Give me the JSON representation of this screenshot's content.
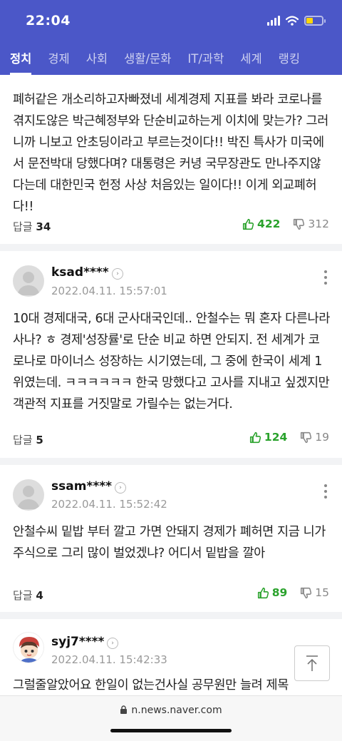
{
  "status": {
    "time": "22:04"
  },
  "nav": {
    "tabs": [
      "정치",
      "경제",
      "사회",
      "생활/문화",
      "IT/과학",
      "세계",
      "랭킹"
    ]
  },
  "comments": [
    {
      "text": "폐허같은 개소리하고자빠졌네 세계경제 지표를 봐라 코로나를 겪지도않은 박근혜정부와 단순비교하는게 이치에 맞는가? 그러니까 니보고 안초딩이라고 부르는것이다!! 박진 특사가 미국에서 문전박대 당했다며? 대통령은 커녕 국무장관도 만나주지않다는데 대한민국 헌정 사상 처음있는 일이다!! 이게 외교폐허다!!",
      "reply_label": "답글",
      "reply_count": "34",
      "likes": "422",
      "dislikes": "312"
    },
    {
      "user": "ksad****",
      "date": "2022.04.11. 15:57:01",
      "text": "10대 경제대국, 6대 군사대국인데.. 안철수는 뭐 혼자 다른나라 사나? ㅎ 경제'성장률'로 단순 비교 하면 안되지. 전 세계가 코로나로 마이너스 성장하는 시기였는데, 그 중에 한국이 세계 1위였는데. ㅋㅋㅋㅋㅋㅋ 한국 망했다고 고사를 지내고 싶겠지만 객관적 지표를 거짓말로 가릴수는 없는거다.",
      "reply_label": "답글",
      "reply_count": "5",
      "likes": "124",
      "dislikes": "19"
    },
    {
      "user": "ssam****",
      "date": "2022.04.11. 15:52:42",
      "text": "안철수씨 밑밥 부터 깔고 가면 안돼지 경제가 폐허면 지금 니가 주식으로 그리 많이 벌었겠냐? 어디서 밑밥을 깔아",
      "reply_label": "답글",
      "reply_count": "4",
      "likes": "89",
      "dislikes": "15"
    },
    {
      "user": "syj7****",
      "date": "2022.04.11. 15:42:33",
      "text": "그럴줄알았어요 한일이 없는건사실 공무원만 늘려 제목"
    }
  ],
  "browser": {
    "url": "n.news.naver.com"
  },
  "colors": {
    "header": "#4b57c8",
    "like": "#2aa22c",
    "dislike": "#888888"
  },
  "icons": {
    "like": "thumbs-up-icon",
    "dislike": "thumbs-down-icon",
    "more": "kebab-menu-icon",
    "scroll_top": "arrow-up-icon",
    "lock": "lock-icon"
  }
}
